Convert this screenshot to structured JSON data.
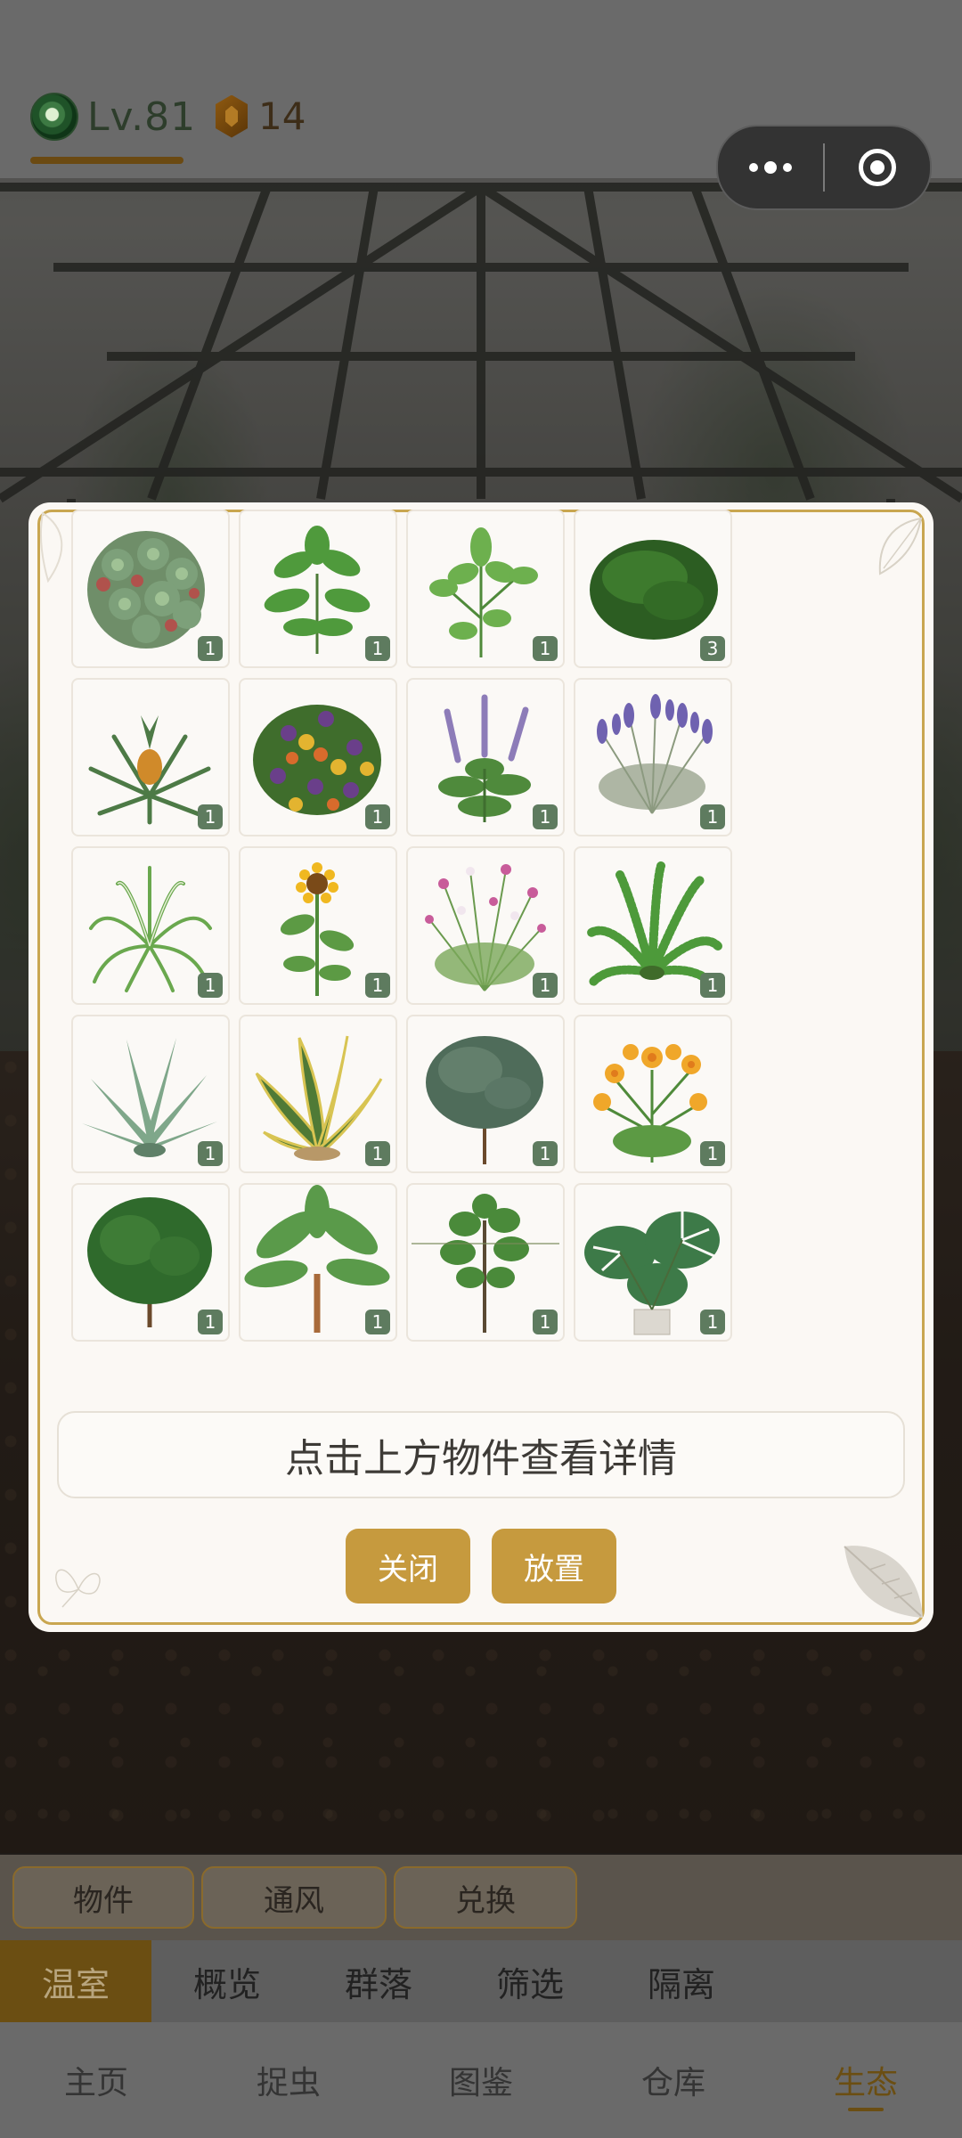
{
  "header": {
    "level_text": "Lv.81",
    "coin_count": "14"
  },
  "capsule": {
    "more_icon": "more-dots-icon",
    "close_icon": "target-icon"
  },
  "inventory": {
    "items": [
      {
        "name": "succulent",
        "count": "1"
      },
      {
        "name": "basil",
        "count": "1"
      },
      {
        "name": "mint",
        "count": "1"
      },
      {
        "name": "boxwood",
        "count": "3"
      },
      {
        "name": "pineapple",
        "count": "1"
      },
      {
        "name": "pansy",
        "count": "1"
      },
      {
        "name": "salvia",
        "count": "1"
      },
      {
        "name": "lavender",
        "count": "1"
      },
      {
        "name": "spider-plant",
        "count": "1"
      },
      {
        "name": "sunflower",
        "count": "1"
      },
      {
        "name": "cosmos",
        "count": "1"
      },
      {
        "name": "fern",
        "count": "1"
      },
      {
        "name": "aloe",
        "count": "1"
      },
      {
        "name": "snake-plant",
        "count": "1"
      },
      {
        "name": "rosemary",
        "count": "1"
      },
      {
        "name": "marigold",
        "count": "1"
      },
      {
        "name": "ficus",
        "count": "1"
      },
      {
        "name": "banana-plant",
        "count": "1"
      },
      {
        "name": "fiddle-leaf-fig",
        "count": "1"
      },
      {
        "name": "monstera",
        "count": "1"
      }
    ]
  },
  "modal": {
    "hint": "点击上方物件查看详情",
    "close_label": "关闭",
    "place_label": "放置"
  },
  "toolbar": {
    "items": [
      "物件",
      "通风",
      "兑换"
    ]
  },
  "tabs": {
    "items": [
      "温室",
      "概览",
      "群落",
      "筛选",
      "隔离"
    ],
    "active": "温室"
  },
  "nav": {
    "items": [
      "主页",
      "捉虫",
      "图鉴",
      "仓库",
      "生态"
    ],
    "active": "生态"
  },
  "colors": {
    "accent_gold": "#c69a3e",
    "badge_green": "#5e7b5f",
    "active_tab_brown": "#6b4e12"
  }
}
